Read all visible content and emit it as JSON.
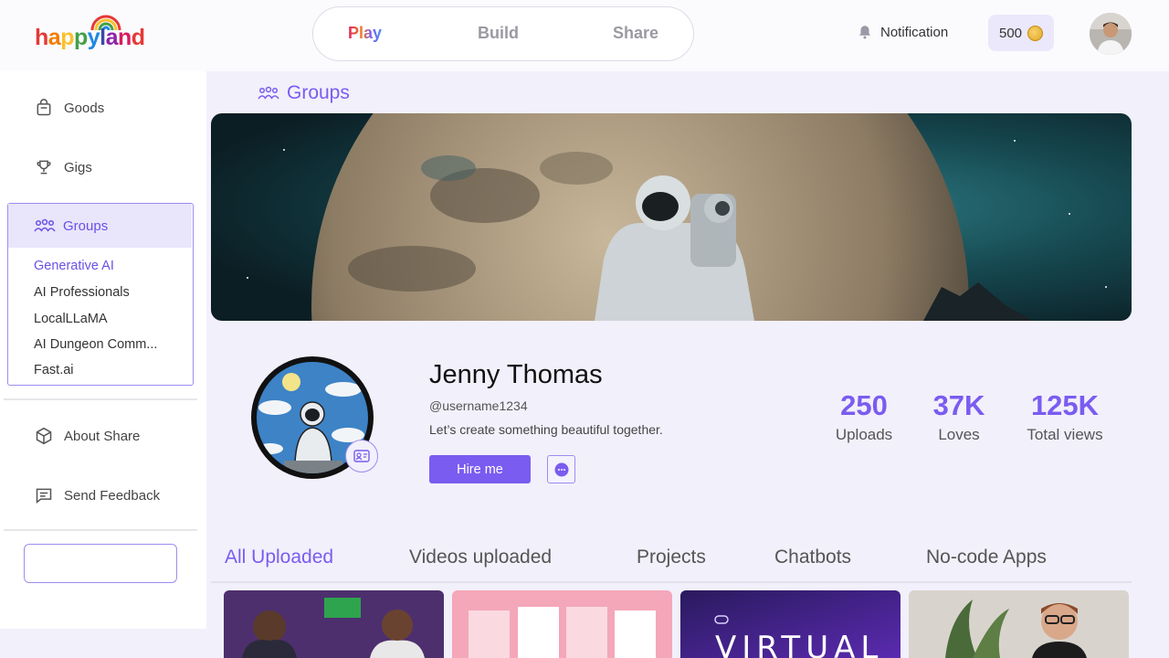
{
  "header": {
    "logo_letters": [
      "h",
      "a",
      "p",
      "p",
      "y",
      "l",
      "a",
      "n",
      "d"
    ],
    "logo_colors": [
      "#e53935",
      "#f57c00",
      "#fbc02d",
      "#43a047",
      "#1e88e5",
      "#3949ab",
      "#8e24aa",
      "#d81b60",
      "#e53935"
    ],
    "tabs": [
      {
        "label": "Play"
      },
      {
        "label": "Build"
      },
      {
        "label": "Share"
      }
    ],
    "notification_label": "Notification",
    "coins": "500"
  },
  "sidebar": {
    "items": [
      {
        "label": "Goods",
        "icon": "bag-icon"
      },
      {
        "label": "Gigs",
        "icon": "trophy-icon"
      }
    ],
    "groups": {
      "label": "Groups",
      "sub_items": [
        "Generative AI",
        "AI Professionals",
        "LocalLLaMA",
        "AI Dungeon Comm...",
        "Fast.ai"
      ]
    },
    "bottom_items": [
      {
        "label": "About Share",
        "icon": "cube-icon"
      },
      {
        "label": "Send Feedback",
        "icon": "feedback-icon"
      }
    ]
  },
  "main": {
    "section_title": "Groups",
    "profile": {
      "name": "Jenny Thomas",
      "username": "@username1234",
      "bio": "Let’s create something beautiful together.",
      "hire_label": "Hire me"
    },
    "stats": [
      {
        "value": "250",
        "label": "Uploads"
      },
      {
        "value": "37K",
        "label": "Loves"
      },
      {
        "value": "125K",
        "label": "Total views"
      }
    ],
    "content_tabs": [
      "All Uploaded",
      "Videos uploaded",
      "Projects",
      "Chatbots",
      "No-code Apps"
    ],
    "thumb_texts": [
      "VIRTUAL"
    ]
  },
  "colors": {
    "accent": "#7a5cf0",
    "accent_light": "#e9e5fb",
    "page_bg": "#f2f0fb"
  }
}
